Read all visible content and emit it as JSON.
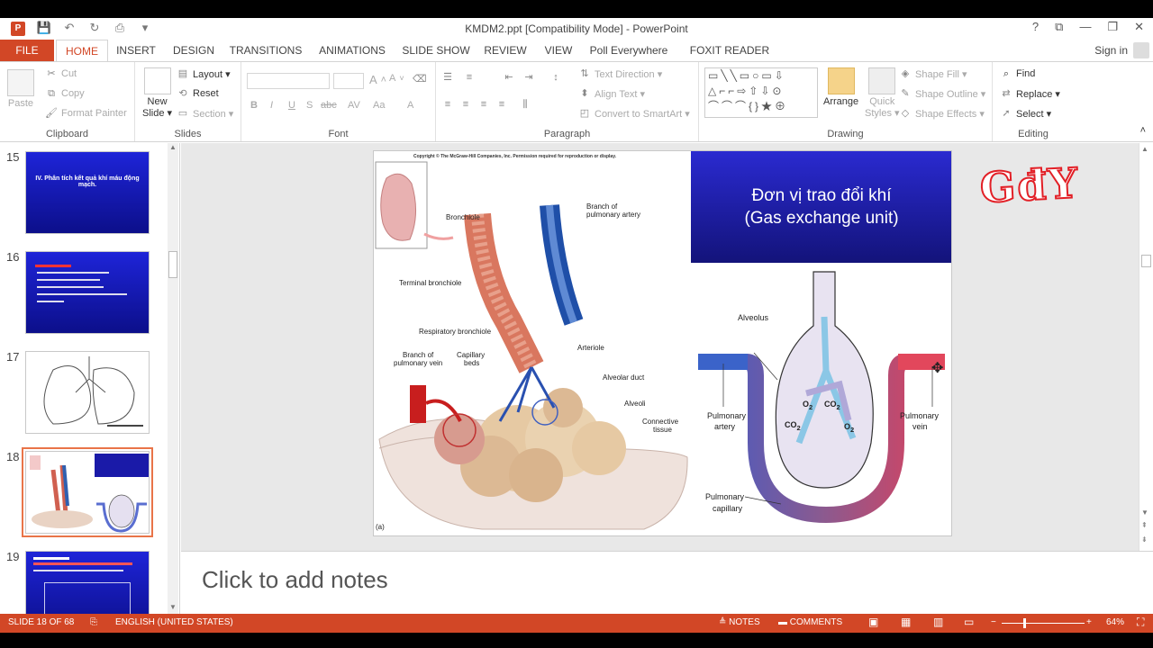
{
  "window": {
    "title": "KMDM2.ppt [Compatibility Mode] - PowerPoint",
    "help": "?",
    "controls": [
      "⧉",
      "—",
      "❐",
      "✕"
    ]
  },
  "quick_access": [
    "💾",
    "↶",
    "↻",
    "⎙",
    "▾"
  ],
  "tabs": [
    {
      "label": "FILE"
    },
    {
      "label": "HOME"
    },
    {
      "label": "INSERT"
    },
    {
      "label": "DESIGN"
    },
    {
      "label": "TRANSITIONS"
    },
    {
      "label": "ANIMATIONS"
    },
    {
      "label": "SLIDE SHOW"
    },
    {
      "label": "REVIEW"
    },
    {
      "label": "VIEW"
    },
    {
      "label": "Poll Everywhere"
    },
    {
      "label": "FOXIT READER PDF"
    }
  ],
  "sign_in": "Sign in",
  "ribbon": {
    "clipboard": {
      "label": "Clipboard",
      "paste": "Paste",
      "cut": "Cut",
      "copy": "Copy",
      "format_painter": "Format Painter"
    },
    "slides": {
      "label": "Slides",
      "new_slide": "New",
      "new_slide2": "Slide ▾",
      "layout": "Layout ▾",
      "reset": "Reset",
      "section": "Section ▾"
    },
    "font": {
      "label": "Font",
      "bold": "B",
      "italic": "I",
      "underline": "U",
      "shadow": "S",
      "strike": "abc",
      "spacing": "AV",
      "case": "Aa",
      "color": "A"
    },
    "paragraph": {
      "label": "Paragraph",
      "text_direction": "Text Direction ▾",
      "align_text": "Align Text ▾",
      "smartart": "Convert to SmartArt ▾"
    },
    "drawing": {
      "label": "Drawing",
      "arrange": "Arrange",
      "quick_styles": "Quick",
      "quick_styles2": "Styles ▾",
      "shape_fill": "Shape Fill ▾",
      "shape_outline": "Shape Outline ▾",
      "shape_effects": "Shape Effects ▾"
    },
    "editing": {
      "label": "Editing",
      "find": "Find",
      "replace": "Replace ▾",
      "select": "Select ▾"
    }
  },
  "thumbnails": [
    {
      "number": "15",
      "text": "IV. Phân tích kết quả khí máu động mạch."
    },
    {
      "number": "16",
      "text": ""
    },
    {
      "number": "17",
      "text": ""
    },
    {
      "number": "18",
      "text": ""
    },
    {
      "number": "19",
      "text": ""
    }
  ],
  "slide": {
    "copyright": "Copyright © The McGraw-Hill Companies, Inc. Permission required for reproduction or display.",
    "title_line1": "Đơn vị trao đổi khí",
    "title_line2": "(Gas exchange unit)",
    "labels": {
      "bronchiole": "Bronchiole",
      "branch_artery": "Branch of",
      "branch_artery2": "pulmonary artery",
      "terminal": "Terminal bronchiole",
      "respiratory": "Respiratory bronchiole",
      "branch_vein": "Branch of",
      "branch_vein2": "pulmonary vein",
      "capillary": "Capillary",
      "capillary2": "beds",
      "arteriole": "Arteriole",
      "alveolar_duct": "Alveolar duct",
      "alveoli": "Alveoli",
      "connective": "Connective",
      "connective2": "tissue",
      "fig_a": "(a)",
      "alveolus": "Alveolus",
      "pa": "Pulmonary",
      "pa2": "artery",
      "pv": "Pulmonary",
      "pv2": "vein",
      "pc": "Pulmonary",
      "pc2": "capillary",
      "o2a": "O",
      "co2a": "CO",
      "co2b": "CO",
      "o2b": "O"
    }
  },
  "watermark": "GđY",
  "notes_placeholder": "Click to add notes",
  "status": {
    "slide_pos": "SLIDE 18 OF 68",
    "language": "ENGLISH (UNITED STATES)",
    "notes": "NOTES",
    "comments": "COMMENTS",
    "zoom": "64%"
  },
  "colors": {
    "accent": "#d24726",
    "slide_title_bg": "#1e1eb4"
  }
}
